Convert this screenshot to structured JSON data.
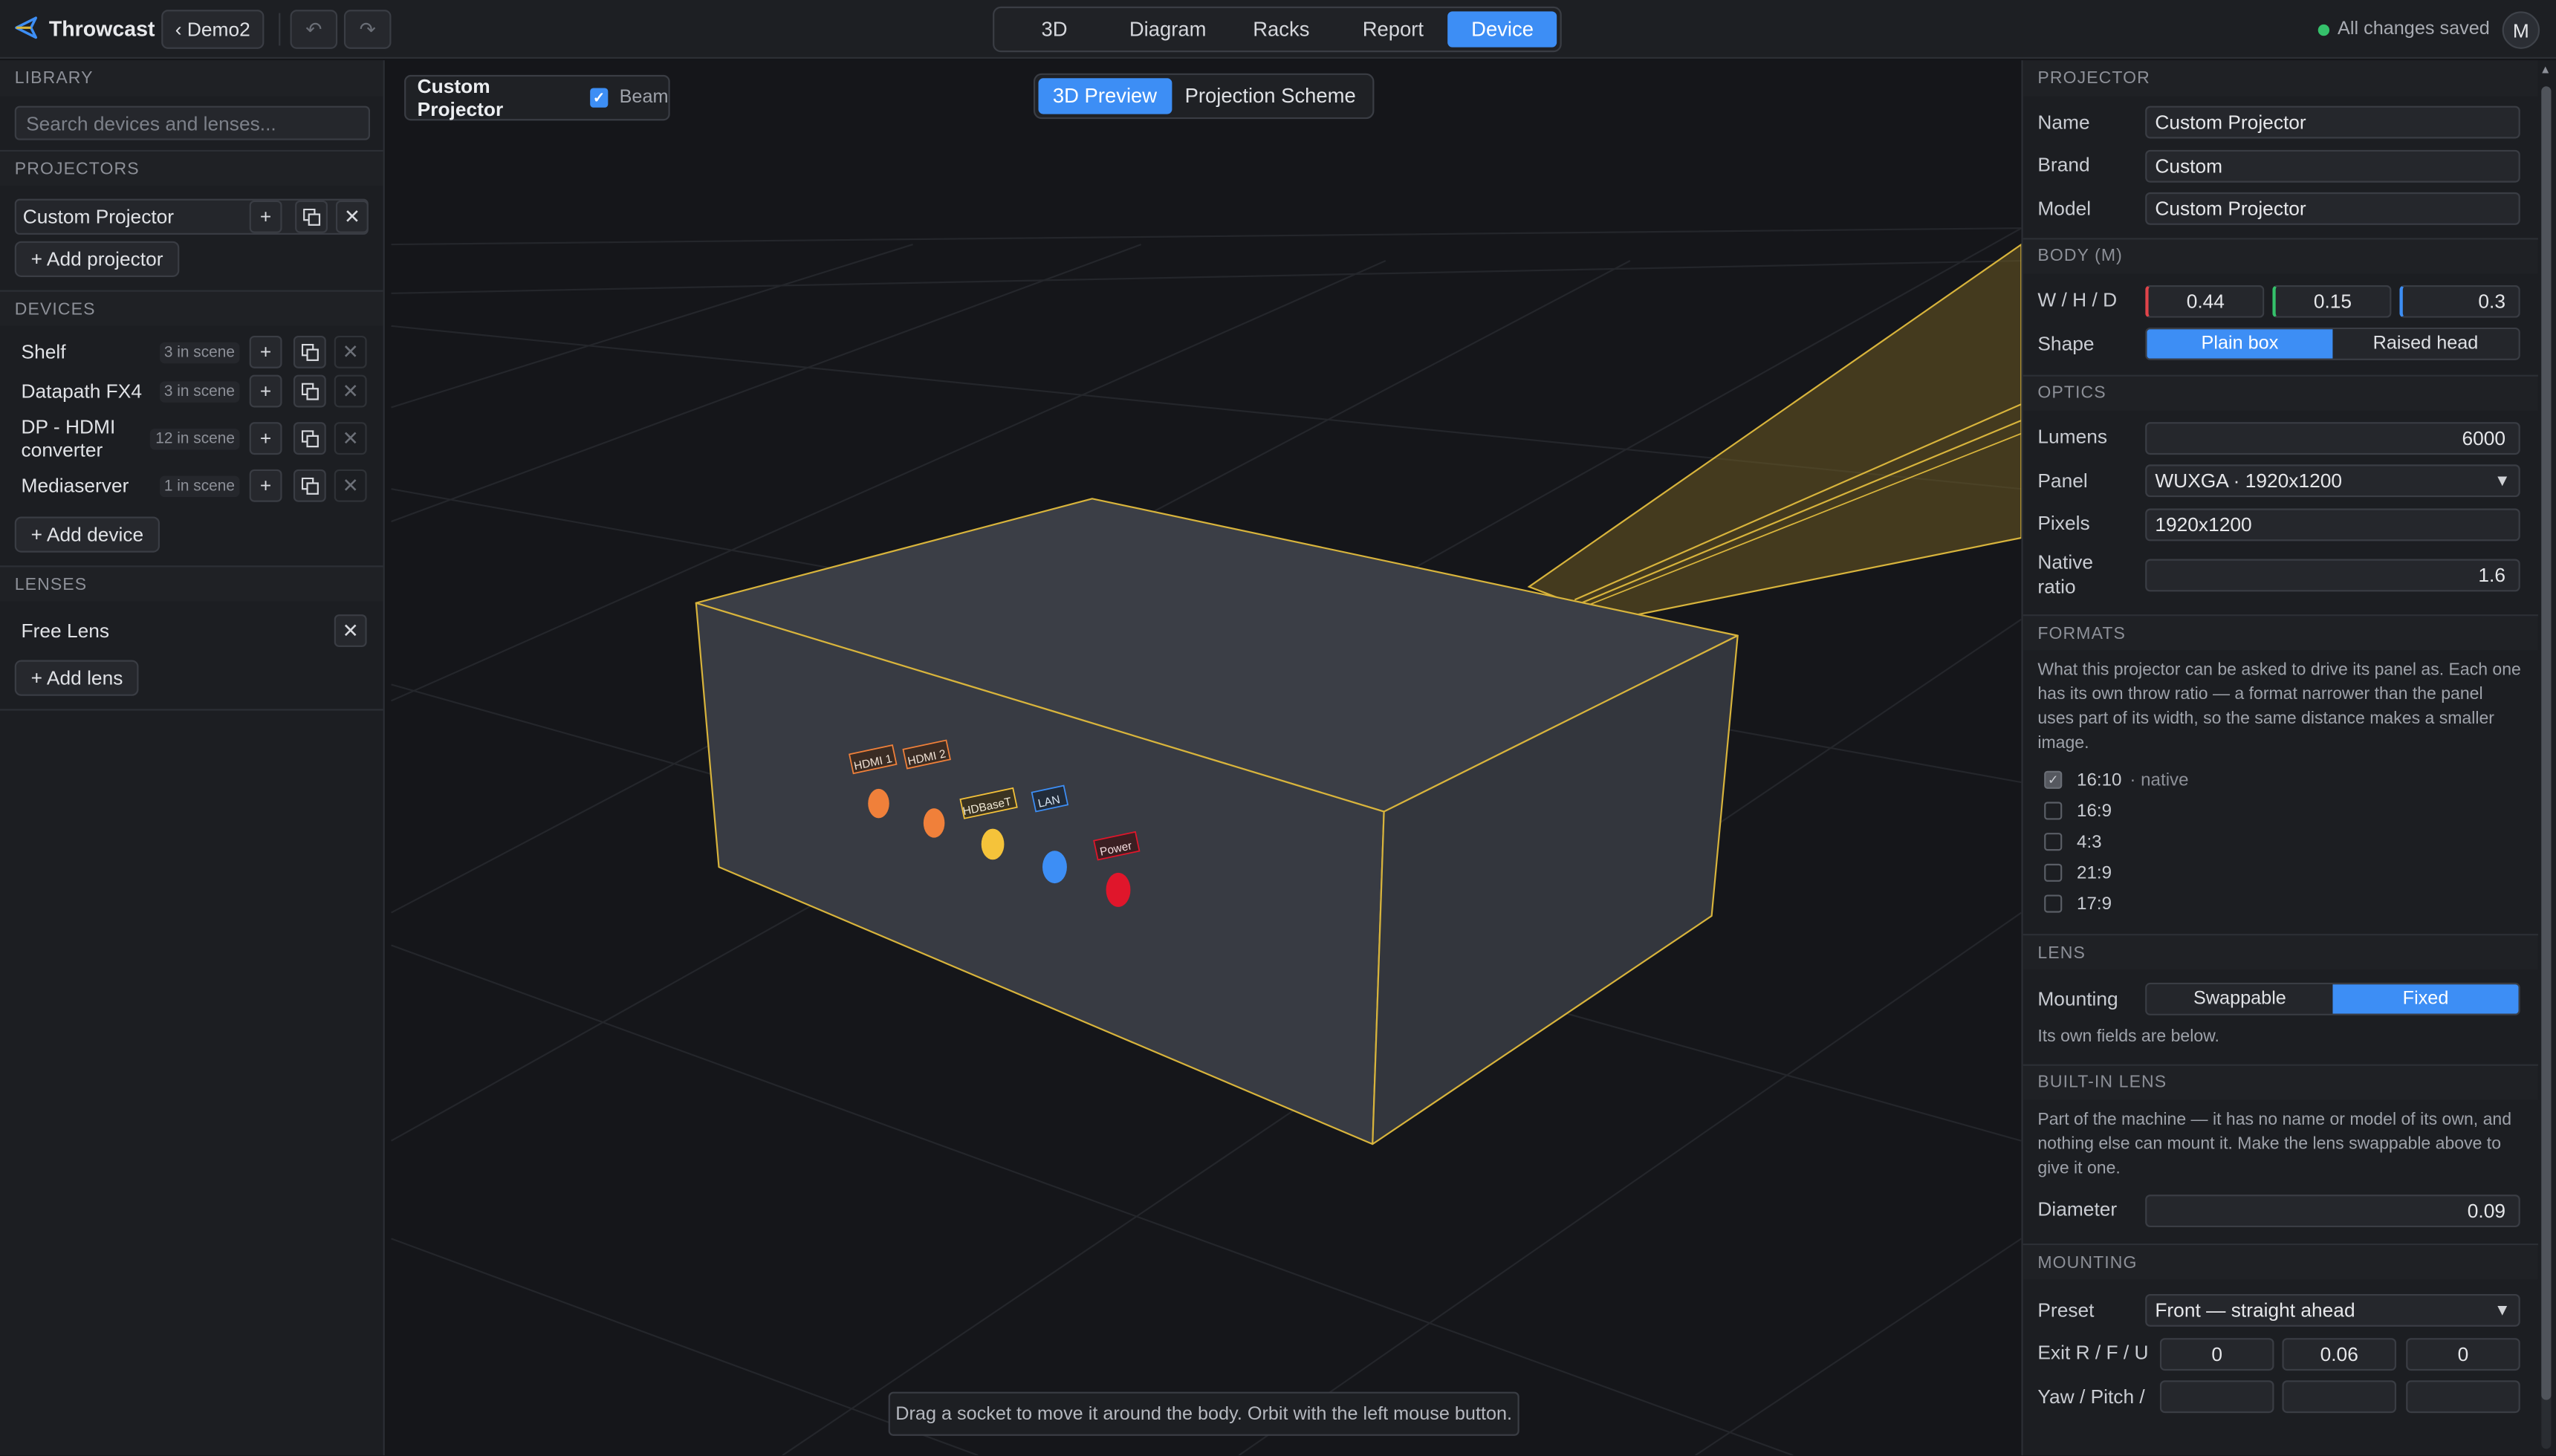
{
  "app": {
    "name": "Throwcast",
    "project_button": "‹ Demo2",
    "undo": "↶",
    "redo": "↷",
    "saved_status": "All changes saved",
    "avatar_initial": "M"
  },
  "nav": {
    "tabs": [
      "3D",
      "Diagram",
      "Racks",
      "Report",
      "Device"
    ],
    "active": "Device"
  },
  "library": {
    "section_label": "LIBRARY",
    "search_placeholder": "Search devices and lenses...",
    "projectors_label": "PROJECTORS",
    "projector_item": "Custom Projector",
    "add_projector": "+ Add projector",
    "devices_label": "DEVICES",
    "devices": [
      {
        "name": "Shelf",
        "count": "3 in scene"
      },
      {
        "name": "Datapath FX4",
        "count": "3 in scene"
      },
      {
        "name": "DP - HDMI converter",
        "count": "12 in scene"
      },
      {
        "name": "Mediaserver",
        "count": "1 in scene"
      }
    ],
    "add_device": "+ Add device",
    "lenses_label": "LENSES",
    "lens_item": "Free Lens",
    "add_lens": "+ Add lens",
    "plus": "+",
    "remove": "✕"
  },
  "viewport": {
    "device_title": "Custom Projector",
    "beam_label": "Beam",
    "beam_checked": true,
    "modes": [
      "3D Preview",
      "Projection Scheme"
    ],
    "active_mode": "3D Preview",
    "sockets": [
      {
        "label": "HDMI 1",
        "color": "#f0803a"
      },
      {
        "label": "HDMI 2",
        "color": "#f0803a"
      },
      {
        "label": "HDBaseT",
        "color": "#f5c33a"
      },
      {
        "label": "LAN",
        "color": "#3d8ef5"
      },
      {
        "label": "Power",
        "color": "#e0162b"
      }
    ],
    "hint": "Drag a socket to move it around the body. Orbit with the left mouse button."
  },
  "inspector": {
    "projector_label": "PROJECTOR",
    "name_label": "Name",
    "name": "Custom Projector",
    "brand_label": "Brand",
    "brand": "Custom",
    "model_label": "Model",
    "model": "Custom Projector",
    "body_label": "BODY (M)",
    "whd_label": "W / H / D",
    "width": "0.44",
    "height": "0.15",
    "depth": "0.3",
    "shape_label": "Shape",
    "shape_options": [
      "Plain box",
      "Raised head"
    ],
    "shape_active": "Plain box",
    "optics_label": "OPTICS",
    "lumens_label": "Lumens",
    "lumens": "6000",
    "panel_label": "Panel",
    "panel": "WUXGA · 1920x1200",
    "pixels_label": "Pixels",
    "pixels": "1920x1200",
    "native_ratio_label": "Native ratio",
    "native_ratio": "1.6",
    "formats_label": "FORMATS",
    "formats_note": "What this projector can be asked to drive its panel as. Each one has its own throw ratio — a format narrower than the panel uses part of its width, so the same distance makes a smaller image.",
    "formats": [
      {
        "label": "16:10",
        "sub": "· native",
        "checked": true
      },
      {
        "label": "16:9",
        "sub": "",
        "checked": false
      },
      {
        "label": "4:3",
        "sub": "",
        "checked": false
      },
      {
        "label": "21:9",
        "sub": "",
        "checked": false
      },
      {
        "label": "17:9",
        "sub": "",
        "checked": false
      }
    ],
    "lens_label": "LENS",
    "mounting_label": "Mounting",
    "mount_options": [
      "Swappable",
      "Fixed"
    ],
    "mount_active": "Fixed",
    "lens_note": "Its own fields are below.",
    "builtin_label": "BUILT-IN LENS",
    "builtin_note": "Part of the machine — it has no name or model of its own, and nothing else can mount it. Make the lens swappable above to give it one.",
    "diameter_label": "Diameter",
    "diameter": "0.09",
    "mounting_section_label": "MOUNTING",
    "preset_label": "Preset",
    "preset": "Front — straight ahead",
    "exit_label": "Exit R / F / U",
    "exit_r": "0",
    "exit_f": "0.06",
    "exit_u": "0",
    "yaw_label": "Yaw / Pitch /"
  },
  "colors": {
    "accent": "#3d8ef5",
    "beam": "#d8b43c",
    "width_axis": "#e0444a",
    "height_axis": "#35c16b",
    "depth_axis": "#3d8ef5"
  }
}
